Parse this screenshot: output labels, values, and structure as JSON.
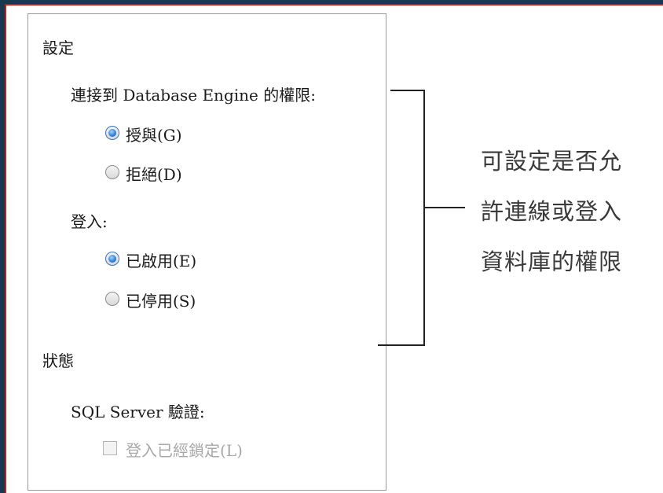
{
  "settings": {
    "heading": "設定",
    "db_permission_label": "連接到 Database Engine 的權限:",
    "grant_label": "授與(G)",
    "deny_label": "拒絕(D)",
    "login_label": "登入:",
    "enabled_label": "已啟用(E)",
    "disabled_label": "已停用(S)"
  },
  "status": {
    "heading": "狀態",
    "auth_label": "SQL Server 驗證:",
    "locked_label": "登入已經鎖定(L)"
  },
  "annotation": {
    "line1": "可設定是否允",
    "line2": "許連線或登入",
    "line3": "資料庫的權限"
  }
}
